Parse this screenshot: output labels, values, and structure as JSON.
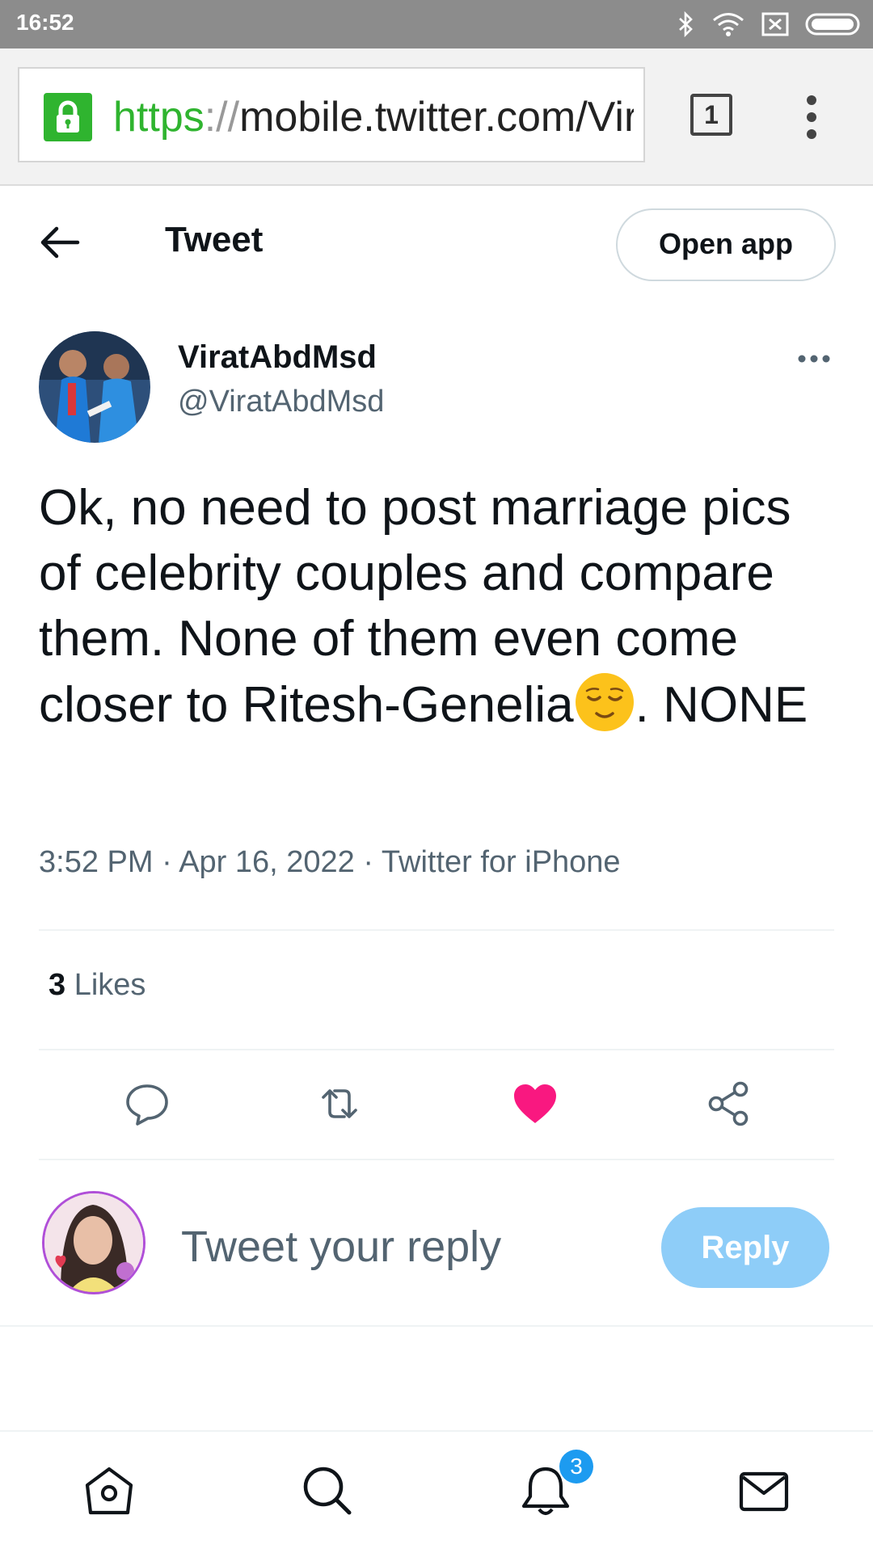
{
  "status_bar": {
    "time": "16:52",
    "icons": [
      "bluetooth-icon",
      "wifi-icon",
      "sim-icon",
      "battery-icon"
    ]
  },
  "browser": {
    "url_scheme": "https",
    "url_sep": "://",
    "url_rest": "mobile.twitter.com/ViratAbdMsd",
    "tab_count": "1"
  },
  "header": {
    "title": "Tweet",
    "open_app_label": "Open app"
  },
  "tweet": {
    "display_name": "ViratAbdMsd",
    "handle": "@ViratAbdMsd",
    "text_before_emoji": "Ok, no need to post marriage pics of celebrity couples and compare them. None of them even come closer to Ritesh-Genelia",
    "emoji": "relieved-face-emoji",
    "text_after_emoji": ". NONE",
    "timestamp": "3:52 PM · Apr 16, 2022 · Twitter for iPhone",
    "likes_count": "3",
    "likes_label": " Likes",
    "liked": true
  },
  "reply": {
    "placeholder": "Tweet your reply",
    "button_label": "Reply"
  },
  "bottom_nav": {
    "notifications_badge": "3"
  },
  "colors": {
    "twitter_blue": "#1d9bf0",
    "like_pink": "#f91880",
    "reply_disabled": "#8ecdf8",
    "muted_text": "#536471"
  }
}
